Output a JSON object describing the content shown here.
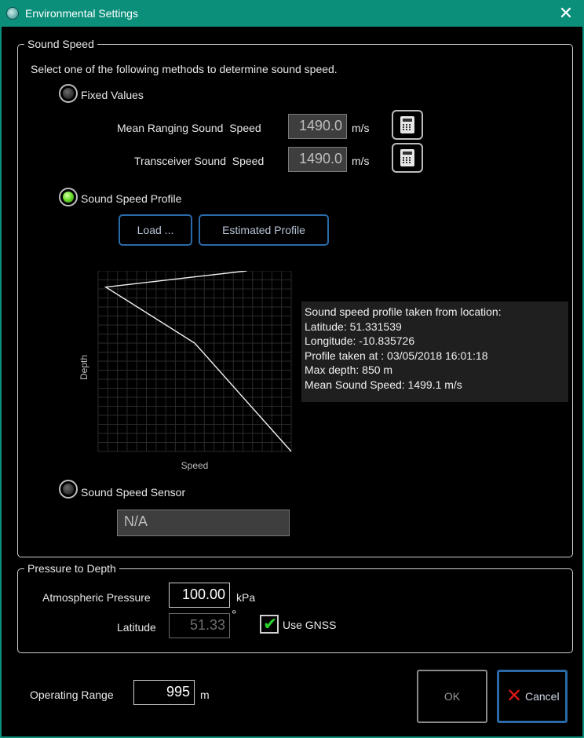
{
  "window": {
    "title": "Environmental Settings",
    "close_glyph": "✕"
  },
  "sound_speed": {
    "legend": "Sound Speed",
    "instruction": "Select one of the following methods to determine sound speed.",
    "fixed_values": {
      "label": "Fixed Values",
      "selected": false,
      "mean_ranging": {
        "label": "Mean Ranging Sound  Speed",
        "value": "1490.0",
        "unit": "m/s"
      },
      "transceiver": {
        "label": "Transceiver Sound  Speed",
        "value": "1490.0",
        "unit": "m/s"
      }
    },
    "profile": {
      "label": "Sound Speed Profile",
      "selected": true,
      "load_label": "Load ...",
      "estimated_label": "Estimated Profile",
      "info": [
        "Sound speed profile taken from location:",
        "Latitude: 51.331539",
        "Longitude: -10.835726",
        "Profile taken at : 03/05/2018 16:01:18",
        "Max depth: 850 m",
        "Mean Sound Speed: 1499.1 m/s"
      ]
    },
    "sensor": {
      "label": "Sound Speed Sensor",
      "selected": false,
      "value": "N/A"
    }
  },
  "chart_data": {
    "type": "line",
    "xlabel": "Speed",
    "ylabel": "Depth",
    "x_range": [
      0,
      1
    ],
    "y_range": [
      0,
      1
    ],
    "y_inverted": true,
    "grid": true,
    "series": [
      {
        "points": [
          [
            0.77,
            0.0
          ],
          [
            0.04,
            0.09
          ],
          [
            0.5,
            0.4
          ],
          [
            1.0,
            1.0
          ]
        ]
      }
    ]
  },
  "pressure_to_depth": {
    "legend": "Pressure to Depth",
    "atmospheric": {
      "label": "Atmospheric Pressure",
      "value": "100.00",
      "unit": "kPa"
    },
    "latitude": {
      "label": "Latitude",
      "value": "51.33",
      "unit": "°"
    },
    "use_gnss": {
      "label": "Use GNSS",
      "checked": true
    }
  },
  "operating_range": {
    "label": "Operating Range",
    "value": "995",
    "unit": "m"
  },
  "buttons": {
    "ok": "OK",
    "cancel": "Cancel"
  },
  "colors": {
    "accent": "#0b8f7b",
    "button_border": "#2a6aa8",
    "radio_on": "#6ee02c",
    "check": "#2bd12b",
    "cancel_x": "#e01818"
  },
  "icons": {
    "app": "app-icon",
    "calculator": "calculator-icon",
    "close": "close-icon",
    "check": "checkmark-icon",
    "cancel": "cancel-x-icon"
  }
}
